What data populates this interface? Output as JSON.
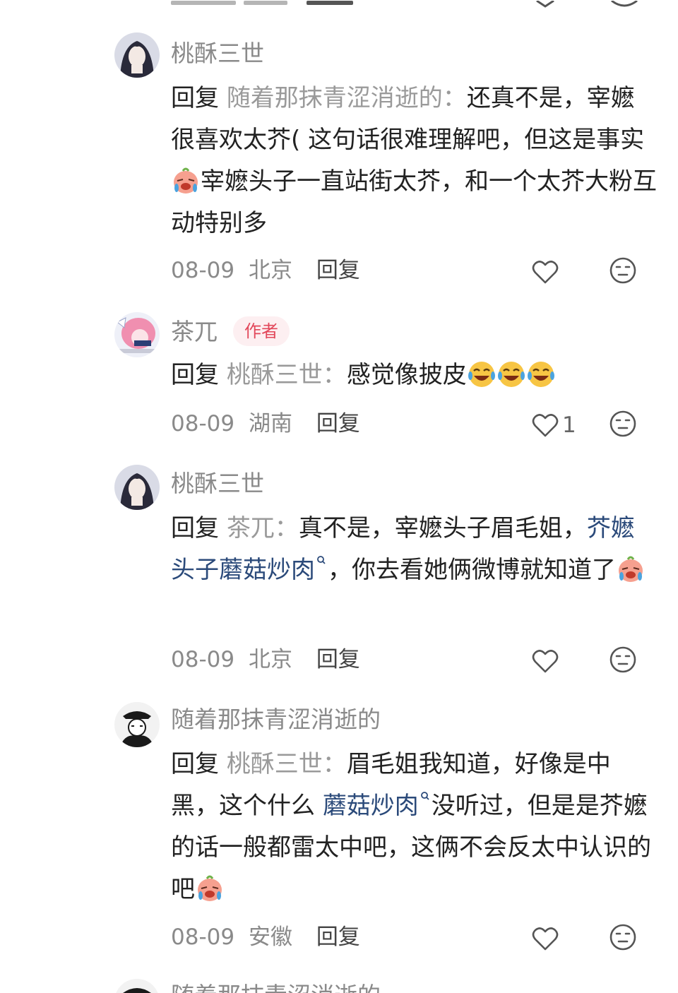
{
  "comments": [
    {
      "user": "桃酥三世",
      "reply_word": "回复",
      "reply_to": "随着那抹青涩消逝的：",
      "text_parts": [
        "还真不是，宰嬷很喜欢太芥( 这句话很难理解吧，但这是事实",
        "宰嬷头子一直站街太芥，和一个太芥大粉互动特别多"
      ],
      "date": "08-09",
      "location": "北京",
      "reply_label": "回复",
      "likes": ""
    },
    {
      "user": "茶兀",
      "badge": "作者",
      "reply_word": "回复",
      "reply_to": "桃酥三世：",
      "text": "感觉像披皮",
      "date": "08-09",
      "location": "湖南",
      "reply_label": "回复",
      "likes": "1"
    },
    {
      "user": "桃酥三世",
      "reply_word": "回复",
      "reply_to": "茶兀：",
      "text_before": "真不是，宰嬷头子眉毛姐，",
      "link": "芥嬷头子蘑菇炒肉",
      "text_after": "，你去看她俩微博就知道了",
      "date": "08-09",
      "location": "北京",
      "reply_label": "回复",
      "likes": ""
    },
    {
      "user": "随着那抹青涩消逝的",
      "reply_word": "回复",
      "reply_to": "桃酥三世：",
      "text_before": "眉毛姐我知道，好像是中黑，这个什么 ",
      "link": "蘑菇炒肉",
      "text_after": "没听过，但是是芥嬷的话一般都雷太中吧，这俩不会反太中认识的吧",
      "date": "08-09",
      "location": "安徽",
      "reply_label": "回复",
      "likes": ""
    },
    {
      "user": "随着那抹青涩消逝的"
    }
  ],
  "colors": {
    "username": "#8a8a8a",
    "link": "#2b4a7a",
    "badge_text": "#e2475a",
    "badge_bg": "#fdeff1"
  },
  "icons": [
    "heart-icon",
    "neutral-face-icon",
    "laughing-emoji",
    "crying-emoji",
    "search-icon"
  ]
}
